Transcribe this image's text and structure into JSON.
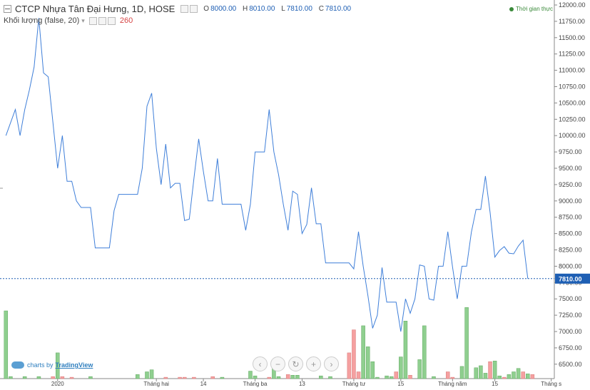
{
  "header": {
    "symbol_title": "CTCP Nhựa Tân Đại Hưng, 1D, HOSE",
    "ohlc": [
      {
        "key": "O",
        "value": "8000.00"
      },
      {
        "key": "H",
        "value": "8010.00"
      },
      {
        "key": "L",
        "value": "7810.00"
      },
      {
        "key": "C",
        "value": "7810.00"
      }
    ],
    "volume_label": "Khối lượng (false, 20)",
    "volume_value": "260",
    "status_text": "Thời gian thực"
  },
  "branding": {
    "prefix": "charts by",
    "name": "TradingView"
  },
  "nav_buttons": [
    "‹",
    "−",
    "↻",
    "+",
    "›"
  ],
  "colors": {
    "line": "#3f7fd9",
    "vol_up": "#8fcf8f",
    "vol_down": "#f5a0a0",
    "price_tag": "#1e5fb4",
    "axis_text": "#444444"
  },
  "chart_data": {
    "type": "line",
    "price_ylim": [
      6300,
      12050
    ],
    "y_ticks": [
      6500,
      6750,
      7000,
      7250,
      7500,
      7750,
      8000,
      8250,
      8500,
      8750,
      9000,
      9250,
      9500,
      9750,
      10000,
      10250,
      10500,
      10750,
      11000,
      11250,
      11500,
      11750,
      12000
    ],
    "y_tick_labels": [
      "6500.00",
      "6750.00",
      "7000.00",
      "7250.00",
      "7500.00",
      "7750.00",
      "8000.00",
      "8250.00",
      "8500.00",
      "8750.00",
      "9000.00",
      "9250.00",
      "9500.00",
      "9750.00",
      "10000.00",
      "10250.00",
      "10500.00",
      "10750.00",
      "11000.00",
      "11250.00",
      "11500.00",
      "11750.00",
      "12000.00"
    ],
    "x_tick_labels": [
      {
        "label": "2020",
        "i": 11
      },
      {
        "label": "Tháng hai",
        "i": 32
      },
      {
        "label": "14",
        "i": 42
      },
      {
        "label": "Tháng ba",
        "i": 53
      },
      {
        "label": "13",
        "i": 63
      },
      {
        "label": "Tháng tư",
        "i": 74
      },
      {
        "label": "15",
        "i": 84
      },
      {
        "label": "Tháng năm",
        "i": 95
      },
      {
        "label": "15",
        "i": 104
      },
      {
        "label": "Tháng s",
        "i": 116
      }
    ],
    "n_bars": 117,
    "last_price": 7810,
    "last_price_label": "7810.00",
    "price_series": [
      [
        0,
        10000
      ],
      [
        2,
        10400
      ],
      [
        3,
        10000
      ],
      [
        4,
        10400
      ],
      [
        5,
        10700
      ],
      [
        6,
        11050
      ],
      [
        7,
        11800
      ],
      [
        8,
        10960
      ],
      [
        9,
        10900
      ],
      [
        10,
        10200
      ],
      [
        11,
        9500
      ],
      [
        12,
        10000
      ],
      [
        13,
        9300
      ],
      [
        14,
        9300
      ],
      [
        15,
        9000
      ],
      [
        16,
        8900
      ],
      [
        18,
        8900
      ],
      [
        19,
        8280
      ],
      [
        22,
        8280
      ],
      [
        23,
        8850
      ],
      [
        24,
        9100
      ],
      [
        28,
        9100
      ],
      [
        29,
        9500
      ],
      [
        30,
        10450
      ],
      [
        31,
        10650
      ],
      [
        32,
        9800
      ],
      [
        33,
        9250
      ],
      [
        34,
        9870
      ],
      [
        35,
        9200
      ],
      [
        36,
        9270
      ],
      [
        37,
        9270
      ],
      [
        38,
        8700
      ],
      [
        39,
        8720
      ],
      [
        40,
        9350
      ],
      [
        41,
        9950
      ],
      [
        42,
        9450
      ],
      [
        43,
        9000
      ],
      [
        44,
        9000
      ],
      [
        45,
        9650
      ],
      [
        46,
        8950
      ],
      [
        50,
        8950
      ],
      [
        51,
        8550
      ],
      [
        52,
        8950
      ],
      [
        53,
        9750
      ],
      [
        55,
        9750
      ],
      [
        56,
        10400
      ],
      [
        57,
        9750
      ],
      [
        58,
        9400
      ],
      [
        59,
        8950
      ],
      [
        60,
        8550
      ],
      [
        61,
        9150
      ],
      [
        62,
        9100
      ],
      [
        63,
        8500
      ],
      [
        64,
        8640
      ],
      [
        65,
        9200
      ],
      [
        66,
        8650
      ],
      [
        67,
        8650
      ],
      [
        68,
        8050
      ],
      [
        73,
        8050
      ],
      [
        74,
        7960
      ],
      [
        75,
        8530
      ],
      [
        76,
        8000
      ],
      [
        77,
        7550
      ],
      [
        78,
        7050
      ],
      [
        79,
        7250
      ],
      [
        80,
        7980
      ],
      [
        81,
        7450
      ],
      [
        83,
        7450
      ],
      [
        84,
        7000
      ],
      [
        85,
        7500
      ],
      [
        86,
        7280
      ],
      [
        87,
        7500
      ],
      [
        88,
        8020
      ],
      [
        89,
        8000
      ],
      [
        90,
        7500
      ],
      [
        91,
        7480
      ],
      [
        92,
        8000
      ],
      [
        93,
        8000
      ],
      [
        94,
        8530
      ],
      [
        95,
        7990
      ],
      [
        96,
        7500
      ],
      [
        97,
        8000
      ],
      [
        98,
        8000
      ],
      [
        99,
        8520
      ],
      [
        100,
        8870
      ],
      [
        101,
        8870
      ],
      [
        102,
        9380
      ],
      [
        103,
        8820
      ],
      [
        104,
        8140
      ],
      [
        105,
        8240
      ],
      [
        106,
        8300
      ],
      [
        107,
        8200
      ],
      [
        108,
        8190
      ],
      [
        109,
        8310
      ],
      [
        110,
        8400
      ],
      [
        111,
        7810
      ]
    ],
    "volume_series": {
      "name": "Khối lượng",
      "unit_note": "relative bar heights",
      "bars": [
        [
          0,
          100,
          "up"
        ],
        [
          1,
          3,
          "up"
        ],
        [
          4,
          3,
          "up"
        ],
        [
          7,
          3,
          "up"
        ],
        [
          10,
          3,
          "down"
        ],
        [
          11,
          38,
          "up"
        ],
        [
          12,
          3,
          "down"
        ],
        [
          14,
          2,
          "down"
        ],
        [
          18,
          3,
          "up"
        ],
        [
          28,
          6,
          "up"
        ],
        [
          30,
          10,
          "up"
        ],
        [
          31,
          13,
          "up"
        ],
        [
          34,
          2,
          "down"
        ],
        [
          37,
          2,
          "down"
        ],
        [
          38,
          2,
          "down"
        ],
        [
          40,
          2,
          "down"
        ],
        [
          44,
          3,
          "down"
        ],
        [
          46,
          2,
          "up"
        ],
        [
          52,
          11,
          "up"
        ],
        [
          53,
          4,
          "up"
        ],
        [
          56,
          2,
          "down"
        ],
        [
          57,
          20,
          "up"
        ],
        [
          58,
          3,
          "up"
        ],
        [
          60,
          6,
          "down"
        ],
        [
          61,
          5,
          "up"
        ],
        [
          62,
          5,
          "up"
        ],
        [
          67,
          4,
          "up"
        ],
        [
          69,
          3,
          "up"
        ],
        [
          73,
          38,
          "down"
        ],
        [
          74,
          72,
          "down"
        ],
        [
          75,
          10,
          "down"
        ],
        [
          76,
          78,
          "up"
        ],
        [
          77,
          47,
          "up"
        ],
        [
          78,
          25,
          "up"
        ],
        [
          79,
          2,
          "up"
        ],
        [
          81,
          4,
          "up"
        ],
        [
          82,
          3,
          "up"
        ],
        [
          83,
          10,
          "down"
        ],
        [
          84,
          32,
          "up"
        ],
        [
          85,
          85,
          "up"
        ],
        [
          86,
          5,
          "down"
        ],
        [
          88,
          28,
          "up"
        ],
        [
          89,
          78,
          "up"
        ],
        [
          91,
          3,
          "up"
        ],
        [
          94,
          10,
          "down"
        ],
        [
          95,
          2,
          "down"
        ],
        [
          97,
          18,
          "up"
        ],
        [
          98,
          105,
          "up"
        ],
        [
          100,
          16,
          "up"
        ],
        [
          101,
          19,
          "up"
        ],
        [
          102,
          8,
          "up"
        ],
        [
          103,
          25,
          "down"
        ],
        [
          104,
          26,
          "up"
        ],
        [
          105,
          4,
          "up"
        ],
        [
          106,
          2,
          "down"
        ],
        [
          107,
          6,
          "up"
        ],
        [
          108,
          10,
          "up"
        ],
        [
          109,
          15,
          "up"
        ],
        [
          110,
          10,
          "down"
        ],
        [
          111,
          7,
          "up"
        ],
        [
          112,
          6,
          "down"
        ]
      ]
    },
    "grid": false,
    "legend_placement": "top-left"
  }
}
